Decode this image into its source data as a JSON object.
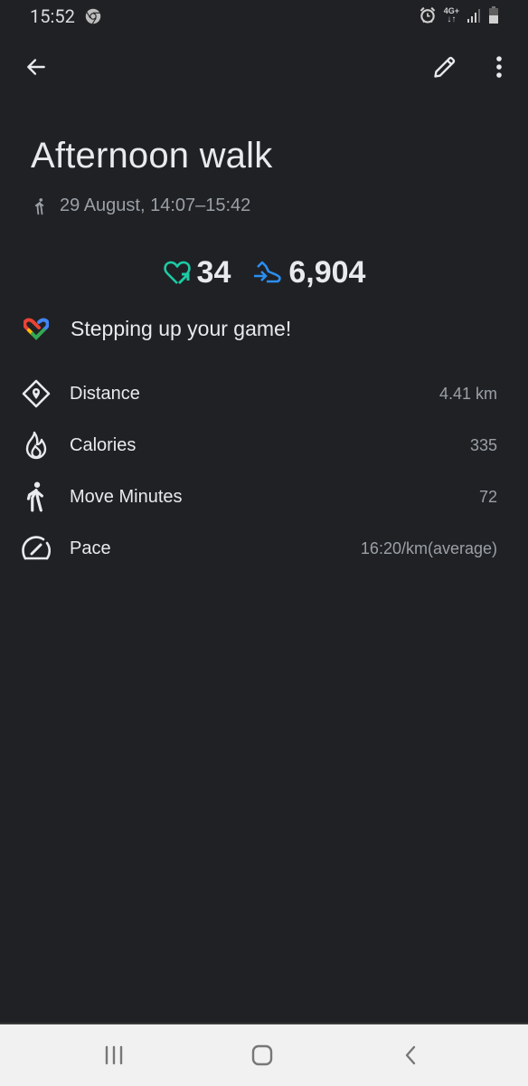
{
  "statusbar": {
    "time": "15:52",
    "network": "4G+",
    "icons": [
      "chrome-icon",
      "alarm-icon",
      "network-4g-icon",
      "signal-icon",
      "battery-icon"
    ]
  },
  "appbar": {
    "back_icon": "arrow-left-icon",
    "edit_icon": "pencil-icon",
    "more_icon": "more-vert-icon"
  },
  "activity": {
    "title": "Afternoon walk",
    "type_icon": "walking-icon",
    "datetime": "29 August, 14:07–15:42"
  },
  "summary": {
    "heart_points": "34",
    "heart_points_icon": "heart-points-icon",
    "steps": "6,904",
    "steps_icon": "steps-icon",
    "colors": {
      "heart": "#1ccaa5",
      "steps": "#2b8ef0"
    }
  },
  "motivation": {
    "icon": "google-fit-logo-icon",
    "text": "Stepping up your game!"
  },
  "metrics": [
    {
      "icon": "distance-icon",
      "label": "Distance",
      "value": "4.41 km"
    },
    {
      "icon": "calories-icon",
      "label": "Calories",
      "value": "335"
    },
    {
      "icon": "move-minutes-icon",
      "label": "Move Minutes",
      "value": "72"
    },
    {
      "icon": "pace-icon",
      "label": "Pace",
      "value": "16:20/km(average)"
    }
  ],
  "navbar": {
    "recents_icon": "recents-icon",
    "home_icon": "home-icon",
    "back_icon": "back-chevron-icon"
  }
}
